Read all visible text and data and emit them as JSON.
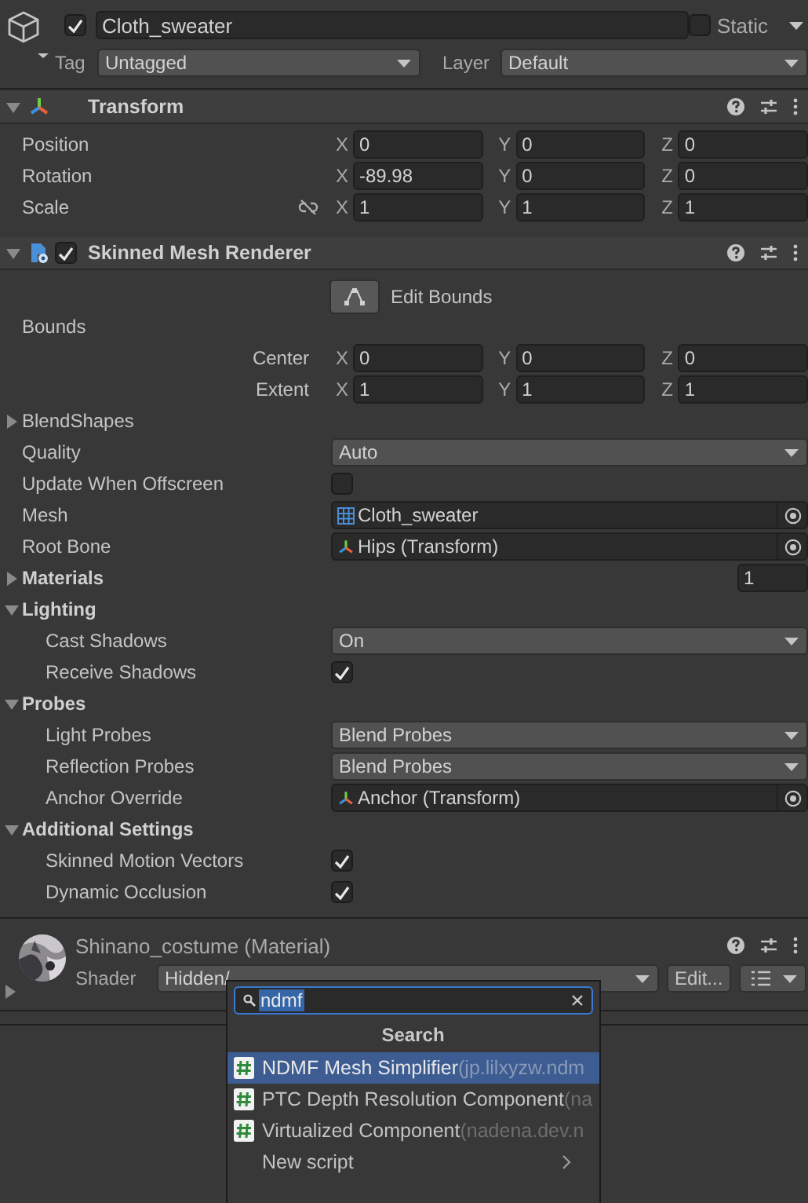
{
  "object": {
    "active": true,
    "name": "Cloth_sweater",
    "static": false,
    "static_label": "Static",
    "tag_label": "Tag",
    "tag": "Untagged",
    "layer_label": "Layer",
    "layer": "Default"
  },
  "transform": {
    "title": "Transform",
    "expanded": true,
    "rows": [
      {
        "kind": "vector",
        "label": "Position",
        "values": [
          {
            "axis": "X",
            "value": "0"
          },
          {
            "axis": "Y",
            "value": "0"
          },
          {
            "axis": "Z",
            "value": "0"
          }
        ]
      },
      {
        "kind": "vector",
        "label": "Rotation",
        "values": [
          {
            "axis": "X",
            "value": "-89.98"
          },
          {
            "axis": "Y",
            "value": "0"
          },
          {
            "axis": "Z",
            "value": "0"
          }
        ]
      },
      {
        "kind": "scale",
        "label": "Scale",
        "values": [
          {
            "axis": "X",
            "value": "1"
          },
          {
            "axis": "Y",
            "value": "1"
          },
          {
            "axis": "Z",
            "value": "1"
          }
        ]
      }
    ]
  },
  "renderer": {
    "title": "Skinned Mesh Renderer",
    "enabled": true,
    "expanded": true,
    "edit_bounds": "Edit Bounds",
    "rows": [
      {
        "kind": "group",
        "label": "Bounds",
        "children": [
          {
            "kind": "vector",
            "label": "Center",
            "values": [
              {
                "axis": "X",
                "value": "0"
              },
              {
                "axis": "Y",
                "value": "0"
              },
              {
                "axis": "Z",
                "value": "0"
              }
            ]
          },
          {
            "kind": "vector",
            "label": "Extent",
            "values": [
              {
                "axis": "X",
                "value": "1"
              },
              {
                "axis": "Y",
                "value": "1"
              },
              {
                "axis": "Z",
                "value": "1"
              }
            ]
          }
        ]
      },
      {
        "kind": "foldout",
        "label": "BlendShapes",
        "expanded": false
      },
      {
        "kind": "dropdown",
        "label": "Quality",
        "value": "Auto"
      },
      {
        "kind": "toggle",
        "label": "Update When Offscreen",
        "checked": false
      },
      {
        "kind": "mesh_ref",
        "label": "Mesh",
        "value": "Cloth_sweater"
      },
      {
        "kind": "transform_ref",
        "label": "Root Bone",
        "value": "Hips (Transform)"
      },
      {
        "kind": "array",
        "label": "Materials",
        "expanded": false,
        "count": "1"
      },
      {
        "kind": "section",
        "label": "Lighting",
        "expanded": true,
        "children": [
          {
            "kind": "dropdown",
            "label": "Cast Shadows",
            "value": "On"
          },
          {
            "kind": "toggle",
            "label": "Receive Shadows",
            "checked": true
          }
        ]
      },
      {
        "kind": "section",
        "label": "Probes",
        "expanded": true,
        "children": [
          {
            "kind": "dropdown",
            "label": "Light Probes",
            "value": "Blend Probes"
          },
          {
            "kind": "dropdown",
            "label": "Reflection Probes",
            "value": "Blend Probes"
          },
          {
            "kind": "transform_ref",
            "label": "Anchor Override",
            "value": "Anchor (Transform)"
          }
        ]
      },
      {
        "kind": "section",
        "label": "Additional Settings",
        "expanded": true,
        "children": [
          {
            "kind": "toggle",
            "label": "Skinned Motion Vectors",
            "checked": true
          },
          {
            "kind": "toggle",
            "label": "Dynamic Occlusion",
            "checked": true
          }
        ]
      }
    ]
  },
  "material": {
    "name": "Shinano_costume (Material)",
    "expanded": false,
    "shader_label": "Shader",
    "shader": "Hidden/",
    "edit": "Edit..."
  },
  "popup": {
    "query": "ndmf",
    "title": "Search",
    "items": [
      {
        "kind": "script",
        "label": "NDMF Mesh Simplifier",
        "package": "(jp.lilxyzw.ndm",
        "selected": true
      },
      {
        "kind": "script",
        "label": "PTC Depth Resolution Component",
        "package": "(na",
        "selected": false
      },
      {
        "kind": "script",
        "label": "Virtualized Component",
        "package": "(nadena.dev.n",
        "selected": false
      },
      {
        "kind": "submenu",
        "label": "New script",
        "selected": false
      }
    ]
  }
}
